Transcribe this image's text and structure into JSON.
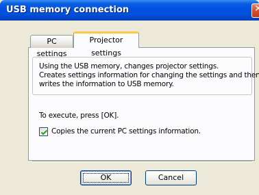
{
  "window": {
    "title": "USB memory connection",
    "close_symbol": "✕"
  },
  "tabs": [
    {
      "label": "PC settings",
      "selected": false
    },
    {
      "label": "Projector settings",
      "selected": true
    }
  ],
  "description": {
    "lines": [
      "Using the USB memory, changes projector settings.",
      "Creates settings information for changing the settings and then",
      "writes the information to USB memory."
    ]
  },
  "execute": {
    "instruction": "To execute, press [OK].",
    "checkbox_label": "Copies the current PC settings information.",
    "checkbox_checked": true
  },
  "buttons": {
    "ok_label": "OK",
    "cancel_label": "Cancel"
  },
  "colors": {
    "titlebar": "#0053e3",
    "active_tab_accent": "#ffc83c",
    "checkmark": "#21a121",
    "close_button": "#d6532f"
  },
  "icons": {
    "close": "close-icon",
    "checkbox": "checkmark-icon"
  }
}
